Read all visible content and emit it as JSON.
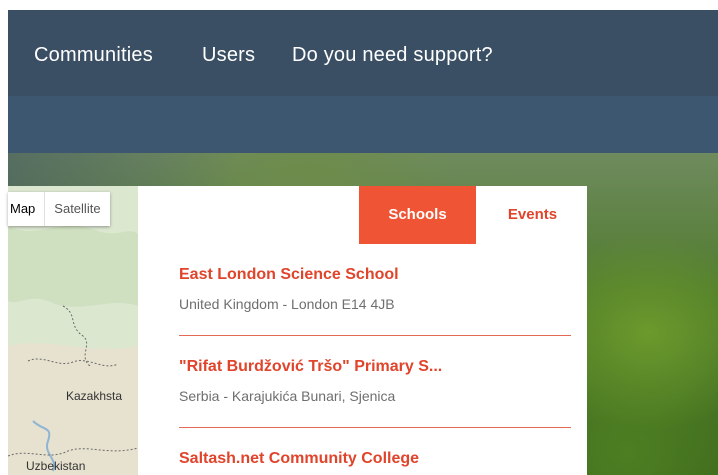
{
  "nav": {
    "items": [
      {
        "label": "Communities"
      },
      {
        "label": "Users"
      },
      {
        "label": "Do you need support?"
      }
    ]
  },
  "map": {
    "modes": [
      {
        "label": "Map",
        "active": true
      },
      {
        "label": "Satellite",
        "active": false
      }
    ],
    "labels": [
      "Kazakhsta",
      "Uzbekistan"
    ]
  },
  "tabs": [
    {
      "label": "Schools",
      "active": true
    },
    {
      "label": "Events",
      "active": false
    }
  ],
  "schools": [
    {
      "name": "East London Science School",
      "address": "United Kingdom - London E14 4JB"
    },
    {
      "name": "\"Rifat Burdžović Tršo\" Primary S...",
      "address": "Serbia - Karajukića Bunari, Sjenica"
    },
    {
      "name": "Saltash.net Community College",
      "address": ""
    }
  ],
  "colors": {
    "accent": "#ef5534",
    "accent_text": "#e0442b",
    "nav_bg": "#3b4f64",
    "subbar_bg": "#3e5770"
  }
}
